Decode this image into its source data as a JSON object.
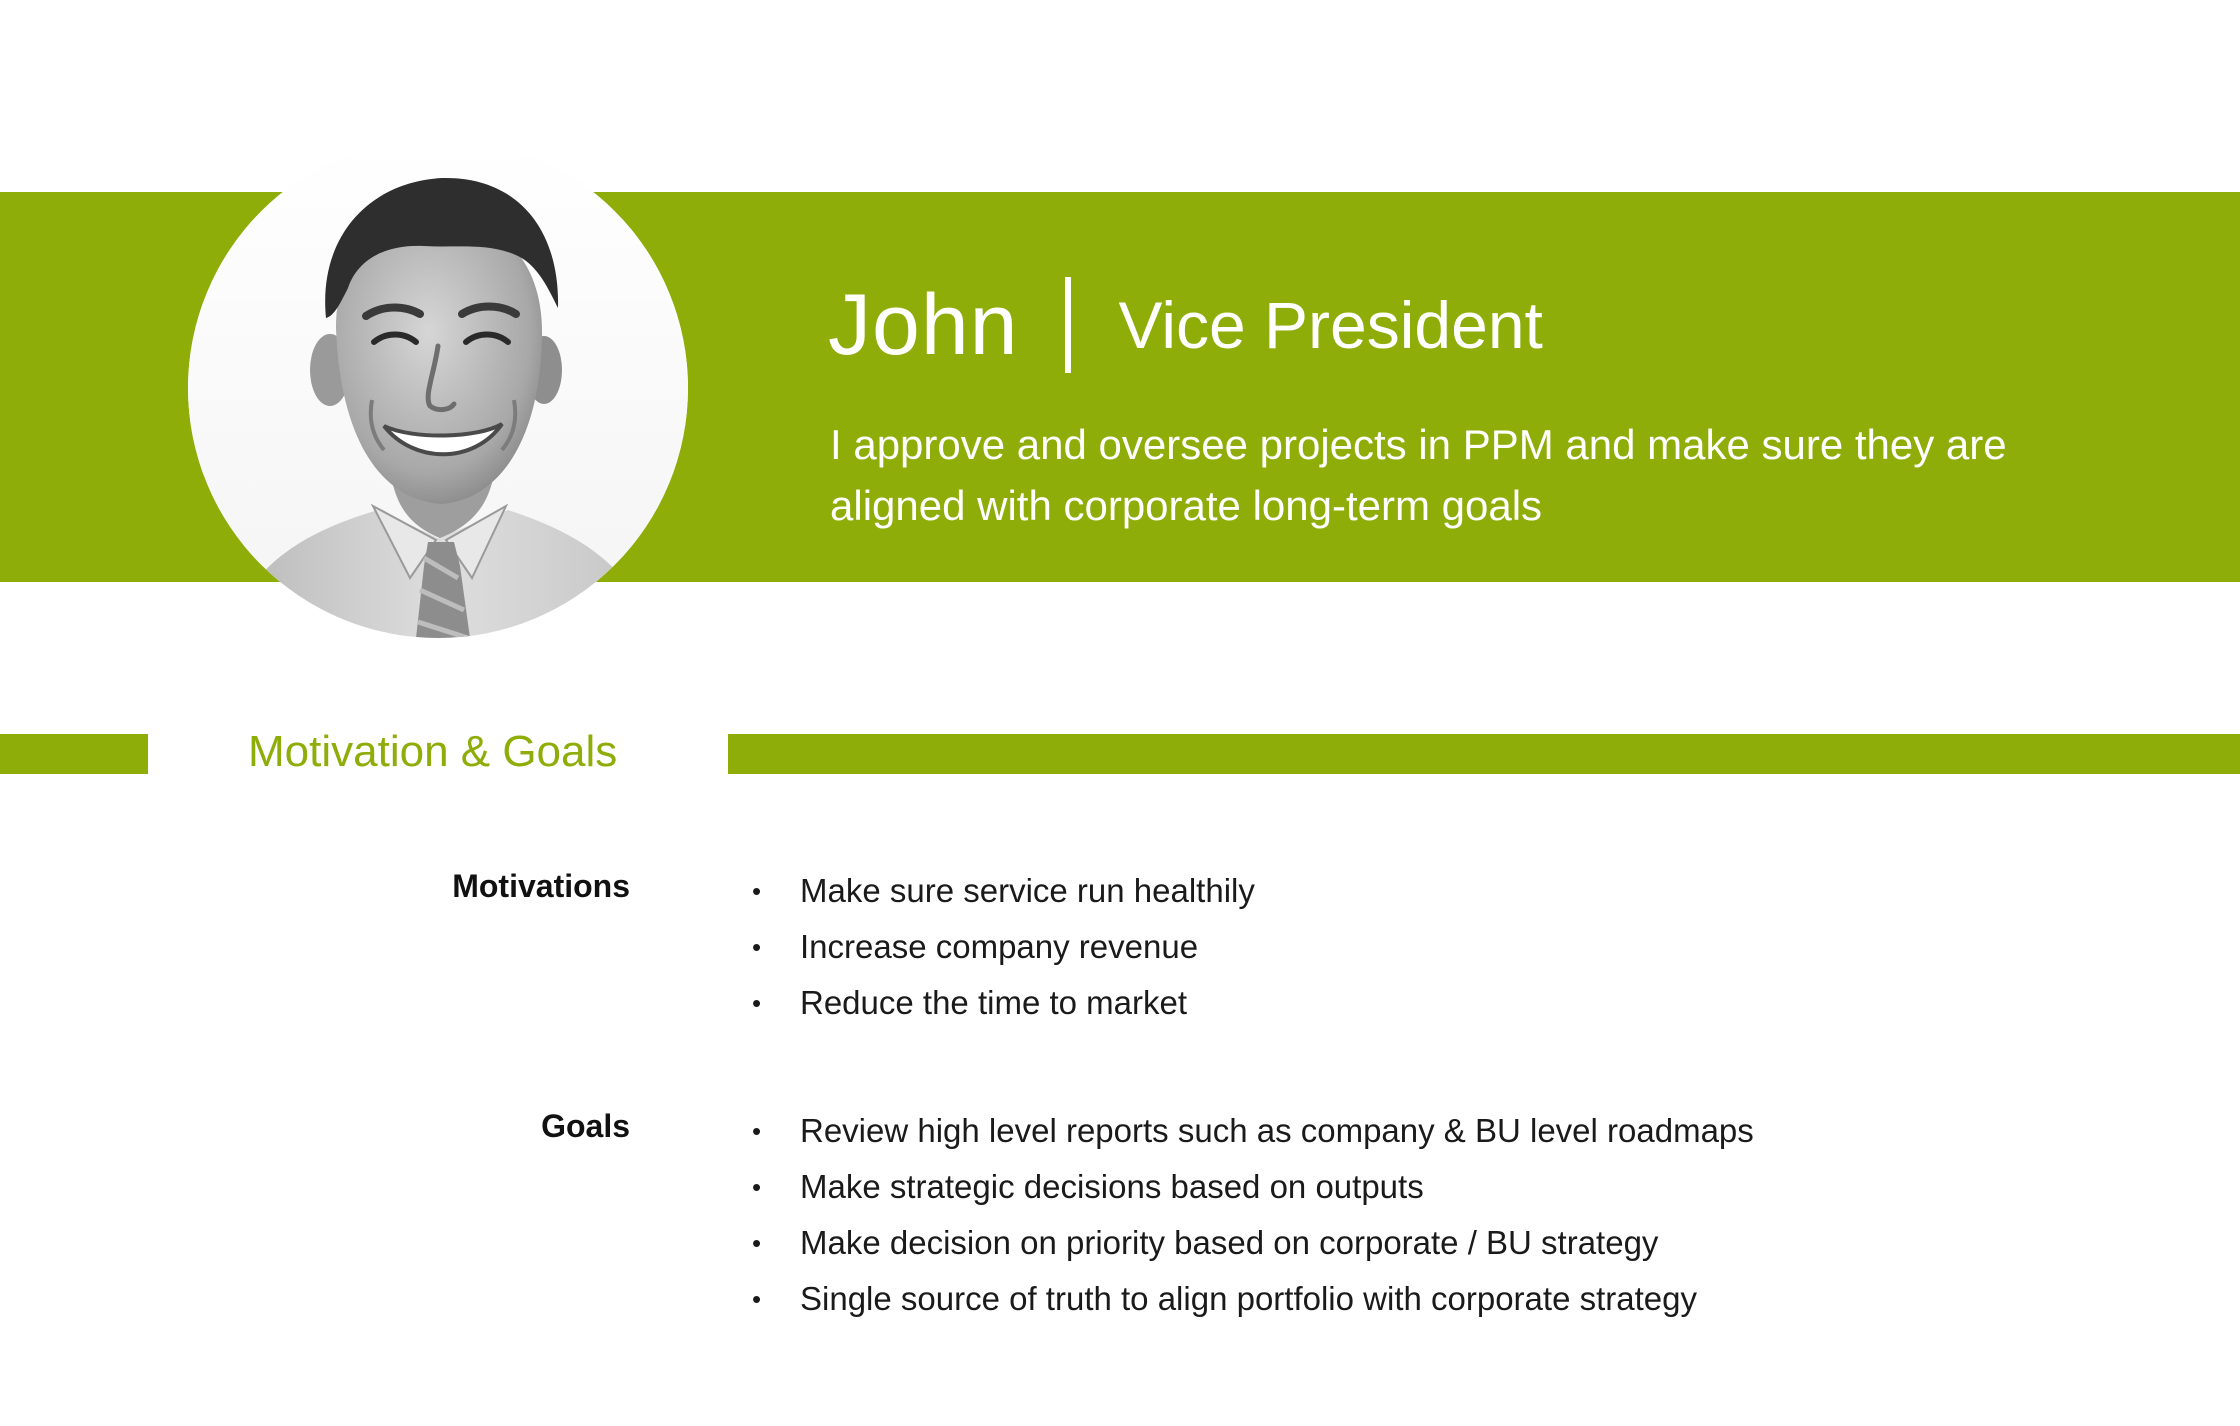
{
  "colors": {
    "accent": "#8fad08",
    "text": "#111111",
    "background": "#ffffff"
  },
  "persona": {
    "name": "John",
    "separator": "|",
    "role": "Vice President",
    "tagline": "I approve and oversee projects in PPM and make sure they are aligned with corporate long-term goals",
    "photo_icon": "person-portrait-icon"
  },
  "section": {
    "title": "Motivation & Goals"
  },
  "motivations": {
    "label": "Motivations",
    "items": [
      "Make sure service run healthily",
      "Increase company revenue",
      "Reduce the time to market"
    ]
  },
  "goals": {
    "label": "Goals",
    "items": [
      "Review high level reports such as company & BU level roadmaps",
      "Make strategic decisions based on outputs",
      "Make decision on priority based on corporate / BU strategy",
      "Single source of truth to align portfolio with corporate strategy"
    ]
  }
}
